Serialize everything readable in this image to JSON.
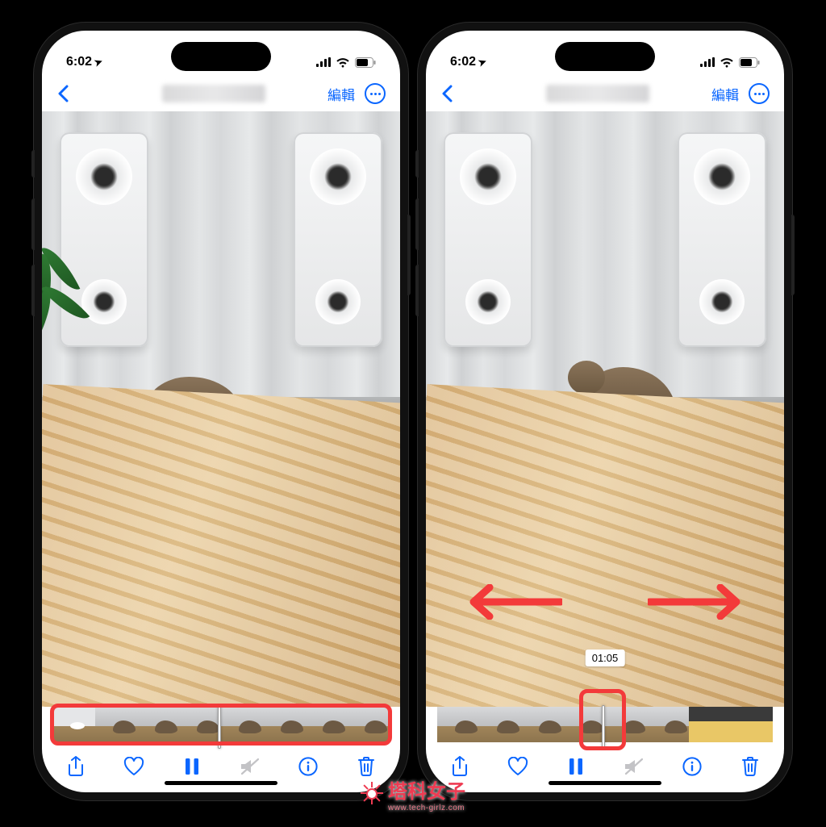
{
  "status": {
    "time": "6:02",
    "location_arrow": "➤"
  },
  "nav": {
    "edit_label": "編輯"
  },
  "toolbar": {
    "share": "share-icon",
    "heart": "heart-icon",
    "pause": "pause-icon",
    "mute": "mute-icon",
    "info": "info-icon",
    "trash": "trash-icon"
  },
  "right_screen": {
    "scrub_timestamp": "01:05"
  },
  "accent_color": "#0A66FF",
  "highlight_color": "#F33A3A",
  "watermark": {
    "name": "塔科女子",
    "url": "www.tech-girlz.com"
  }
}
